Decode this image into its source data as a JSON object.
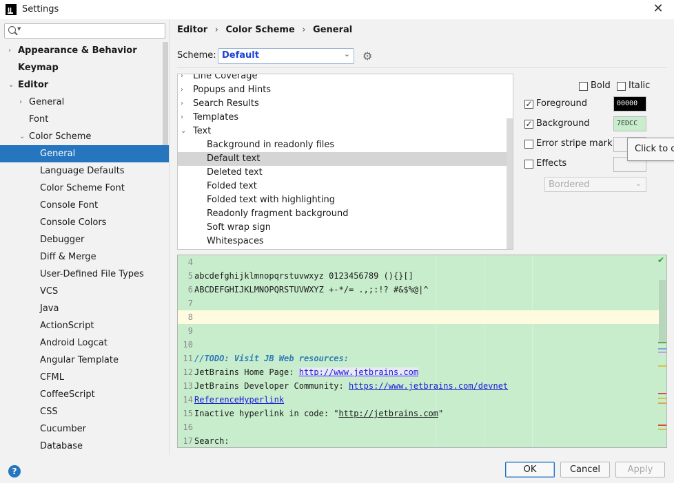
{
  "window": {
    "title": "Settings",
    "app_icon_text": "IJ",
    "close_glyph": "✕"
  },
  "sidebar": {
    "search_placeholder": "",
    "items": [
      {
        "label": "Appearance & Behavior",
        "arrow": "›"
      },
      {
        "label": "Keymap",
        "arrow": ""
      },
      {
        "label": "Editor",
        "arrow": "⌄"
      },
      {
        "label": "General",
        "arrow": "›"
      },
      {
        "label": "Font",
        "arrow": ""
      },
      {
        "label": "Color Scheme",
        "arrow": "⌄"
      },
      {
        "label": "General",
        "arrow": ""
      },
      {
        "label": "Language Defaults",
        "arrow": ""
      },
      {
        "label": "Color Scheme Font",
        "arrow": ""
      },
      {
        "label": "Console Font",
        "arrow": ""
      },
      {
        "label": "Console Colors",
        "arrow": ""
      },
      {
        "label": "Debugger",
        "arrow": ""
      },
      {
        "label": "Diff & Merge",
        "arrow": ""
      },
      {
        "label": "User-Defined File Types",
        "arrow": ""
      },
      {
        "label": "VCS",
        "arrow": ""
      },
      {
        "label": "Java",
        "arrow": ""
      },
      {
        "label": "ActionScript",
        "arrow": ""
      },
      {
        "label": "Android Logcat",
        "arrow": ""
      },
      {
        "label": "Angular Template",
        "arrow": ""
      },
      {
        "label": "CFML",
        "arrow": ""
      },
      {
        "label": "CoffeeScript",
        "arrow": ""
      },
      {
        "label": "CSS",
        "arrow": ""
      },
      {
        "label": "Cucumber",
        "arrow": ""
      },
      {
        "label": "Database",
        "arrow": ""
      }
    ],
    "selected_index": 6
  },
  "breadcrumb": {
    "items": [
      "Editor",
      "Color Scheme",
      "General"
    ],
    "separator": "›"
  },
  "scheme": {
    "label": "Scheme:",
    "value": "Default"
  },
  "attributes": {
    "items": [
      {
        "label": "Line Coverage",
        "arrow": "›"
      },
      {
        "label": "Popups and Hints",
        "arrow": "›"
      },
      {
        "label": "Search Results",
        "arrow": "›"
      },
      {
        "label": "Templates",
        "arrow": "›"
      },
      {
        "label": "Text",
        "arrow": "⌄"
      },
      {
        "label": "Background in readonly files",
        "arrow": ""
      },
      {
        "label": "Default text",
        "arrow": ""
      },
      {
        "label": "Deleted text",
        "arrow": ""
      },
      {
        "label": "Folded text",
        "arrow": ""
      },
      {
        "label": "Folded text with highlighting",
        "arrow": ""
      },
      {
        "label": "Readonly fragment background",
        "arrow": ""
      },
      {
        "label": "Soft wrap sign",
        "arrow": ""
      },
      {
        "label": "Whitespaces",
        "arrow": ""
      }
    ],
    "selected_index": 6
  },
  "options": {
    "bold_label": "Bold",
    "italic_label": "Italic",
    "foreground_label": "Foreground",
    "foreground_value": "00000",
    "foreground_color": "#000000",
    "background_label": "Background",
    "background_value": "7EDCC",
    "background_color": "#c7edcc",
    "error_stripe_label": "Error stripe mark",
    "effects_label": "Effects",
    "effects_value": "Bordered",
    "tooltip": "Click to cu"
  },
  "preview": {
    "lines": [
      {
        "n": "4",
        "text": ""
      },
      {
        "n": "5",
        "text": "abcdefghijklmnopqrstuvwxyz 0123456789 (){}[]"
      },
      {
        "n": "6",
        "text": "ABCDEFGHIJKLMNOPQRSTUVWXYZ +-*/= .,;:!? #&$%@|^"
      },
      {
        "n": "7",
        "text": ""
      },
      {
        "n": "8",
        "text": ""
      },
      {
        "n": "9",
        "text": ""
      },
      {
        "n": "10",
        "text": ""
      },
      {
        "n": "11",
        "text": "//TODO: Visit JB Web resources:"
      },
      {
        "n": "12",
        "text": "JetBrains Home Page: ",
        "link": "http://www.jetbrains.com"
      },
      {
        "n": "13",
        "text": "JetBrains Developer Community: ",
        "link": "https://www.jetbrains.com/devnet"
      },
      {
        "n": "14",
        "text": "",
        "link": "ReferenceHyperlink"
      },
      {
        "n": "15",
        "text": "Inactive hyperlink in code: \"",
        "link": "http://jetbrains.com",
        "suffix": "\""
      },
      {
        "n": "16",
        "text": ""
      },
      {
        "n": "17",
        "text": "Search:"
      }
    ]
  },
  "buttons": {
    "ok": "OK",
    "cancel": "Cancel",
    "apply": "Apply",
    "help": "?"
  }
}
